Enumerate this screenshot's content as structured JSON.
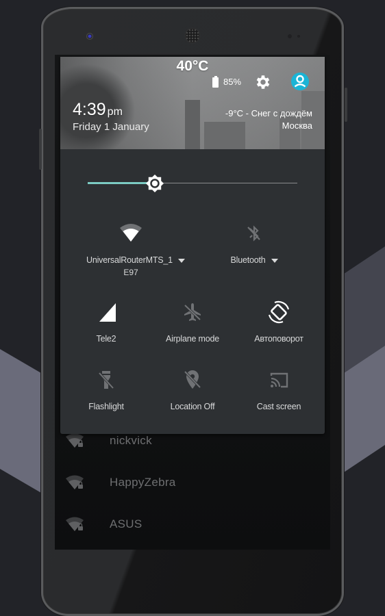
{
  "header": {
    "temperature": "40°C",
    "battery_percent": "85%",
    "battery_level": 0.85,
    "time": "4:39",
    "ampm": "pm",
    "date": "Friday 1 January",
    "weather_line": "-9°C - Снег с дождём",
    "city": "Москва",
    "settings_icon": "gear-icon",
    "user_icon": "account-circle-icon",
    "accent_color": "#1ab4d6"
  },
  "brightness": {
    "level_percent": 32,
    "fill_color": "#7ccbc3",
    "thumb_icon": "brightness-icon"
  },
  "tiles": [
    {
      "id": "wifi",
      "label": "UniversalRouterMTS_1",
      "sublabel": "E97",
      "icon": "wifi-icon",
      "has_dropdown": true,
      "active": true
    },
    {
      "id": "bluetooth",
      "label": "Bluetooth",
      "icon": "bluetooth-disabled-icon",
      "has_dropdown": true,
      "active": false
    },
    {
      "id": "cellular",
      "label": "Tele2",
      "icon": "cell-signal-icon",
      "active": true
    },
    {
      "id": "airplane",
      "label": "Airplane mode",
      "icon": "airplane-off-icon",
      "active": false
    },
    {
      "id": "rotate",
      "label": "Автоповорот",
      "icon": "auto-rotate-icon",
      "active": true
    },
    {
      "id": "flashlight",
      "label": "Flashlight",
      "icon": "flashlight-off-icon",
      "active": false
    },
    {
      "id": "location",
      "label": "Location Off",
      "icon": "location-off-icon",
      "active": false
    },
    {
      "id": "cast",
      "label": "Cast screen",
      "icon": "cast-icon",
      "active": false
    }
  ],
  "wifi_networks": [
    {
      "name": "nickvick",
      "secured": true
    },
    {
      "name": "HappyZebra",
      "secured": true
    },
    {
      "name": "ASUS",
      "secured": true
    }
  ]
}
